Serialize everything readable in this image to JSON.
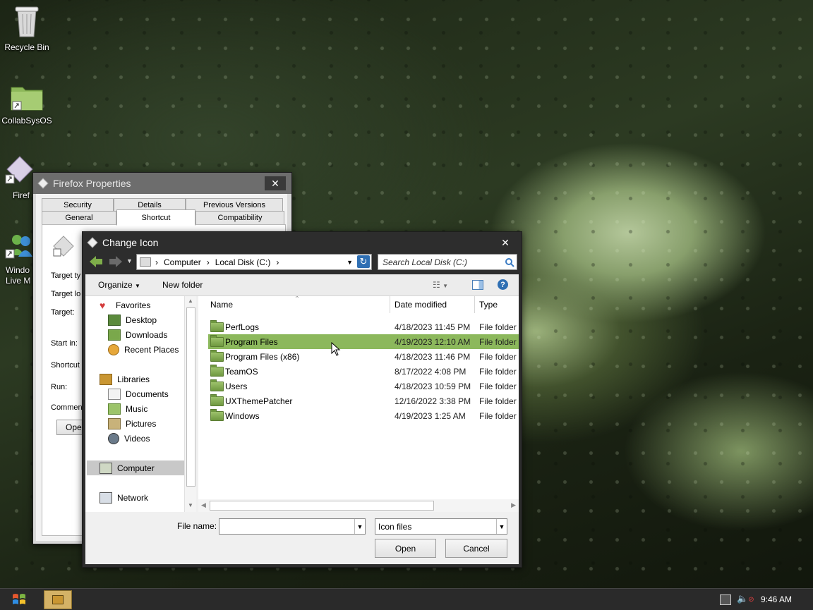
{
  "desktop": {
    "icons": [
      {
        "label": "Recycle Bin"
      },
      {
        "label": "CollabSysOS"
      },
      {
        "label": "Firef"
      },
      {
        "label": "Windo\nLive M"
      }
    ]
  },
  "props_window": {
    "title": "Firefox Properties",
    "tabs_row1": [
      "Security",
      "Details",
      "Previous Versions"
    ],
    "tabs_row2": [
      "General",
      "Shortcut",
      "Compatibility"
    ],
    "active_tab": "Shortcut",
    "labels": [
      "Target ty",
      "Target lo",
      "Target:",
      "Start in:",
      "Shortcut",
      "Run:",
      "Commen"
    ],
    "open_button_label": "Ope"
  },
  "dialog": {
    "title": "Change Icon",
    "breadcrumb": [
      "Computer",
      "Local Disk (C:)"
    ],
    "search_placeholder": "Search Local Disk (C:)",
    "organize_label": "Organize",
    "new_folder_label": "New folder",
    "nav": {
      "favorites": "Favorites",
      "favorites_items": [
        "Desktop",
        "Downloads",
        "Recent Places"
      ],
      "libraries": "Libraries",
      "libraries_items": [
        "Documents",
        "Music",
        "Pictures",
        "Videos"
      ],
      "computer": "Computer",
      "network": "Network"
    },
    "columns": {
      "name": "Name",
      "date": "Date modified",
      "type": "Type"
    },
    "files": [
      {
        "name": "PerfLogs",
        "date": "4/18/2023 11:45 PM",
        "type": "File folder"
      },
      {
        "name": "Program Files",
        "date": "4/19/2023 12:10 AM",
        "type": "File folder"
      },
      {
        "name": "Program Files (x86)",
        "date": "4/18/2023 11:46 PM",
        "type": "File folder"
      },
      {
        "name": "TeamOS",
        "date": "8/17/2022 4:08 PM",
        "type": "File folder"
      },
      {
        "name": "Users",
        "date": "4/18/2023 10:59 PM",
        "type": "File folder"
      },
      {
        "name": "UXThemePatcher",
        "date": "12/16/2022 3:38 PM",
        "type": "File folder"
      },
      {
        "name": "Windows",
        "date": "4/19/2023 1:25 AM",
        "type": "File folder"
      }
    ],
    "selected_file": "Program Files",
    "file_name_label": "File name:",
    "file_name_value": "",
    "filter_value": "Icon files",
    "open_label": "Open",
    "cancel_label": "Cancel"
  },
  "taskbar": {
    "clock": "9:46 AM"
  },
  "colors": {
    "selection": "#8cb85c",
    "titlebar": "#2d2d2d",
    "folder": "#8ab55a"
  }
}
